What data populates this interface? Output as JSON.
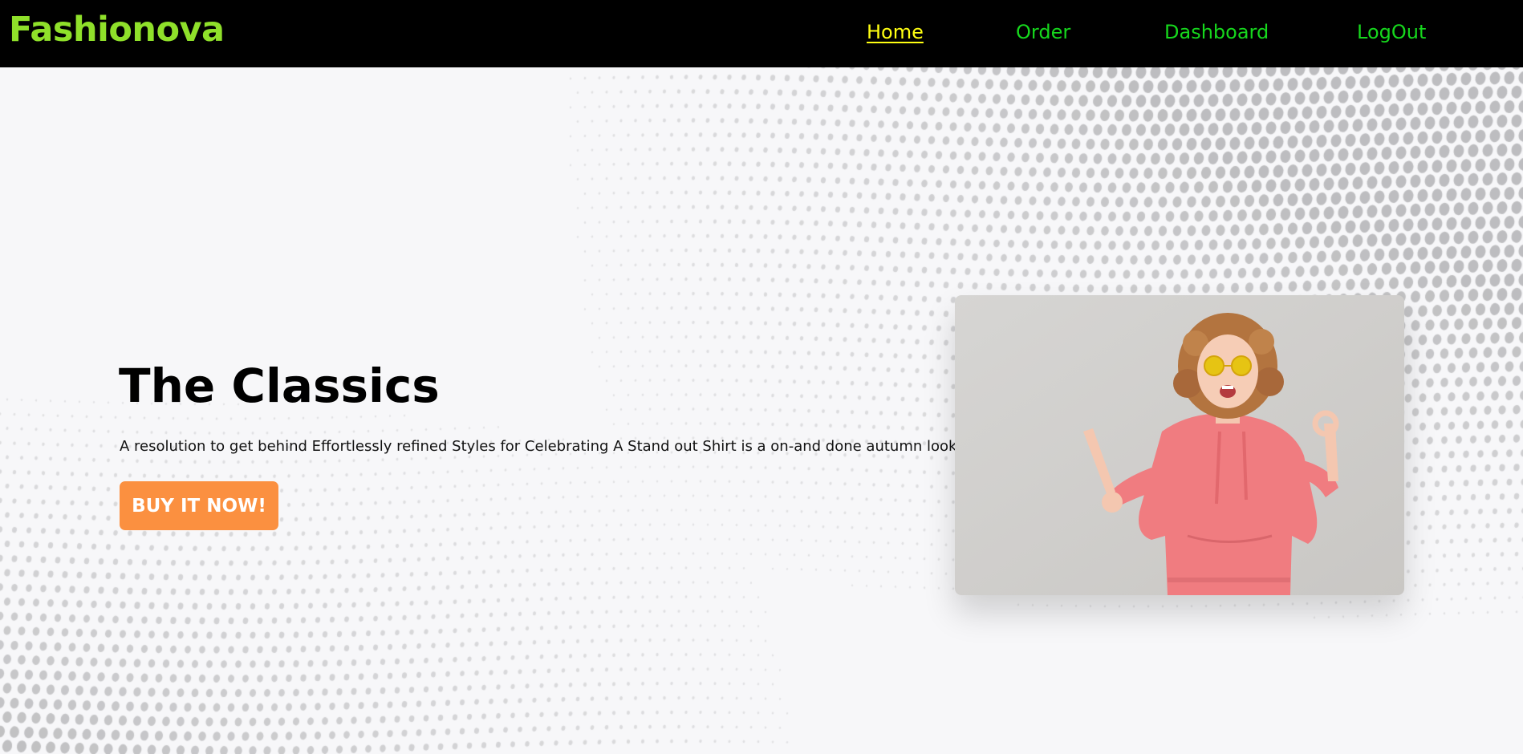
{
  "navbar": {
    "brand": "Fashionova",
    "links": [
      {
        "label": "Home",
        "active": true
      },
      {
        "label": "Order",
        "active": false
      },
      {
        "label": "Dashboard",
        "active": false
      },
      {
        "label": "LogOut",
        "active": false
      }
    ]
  },
  "hero": {
    "title": "The Classics",
    "subtitle": "A resolution to get behind Effortlessly refined Styles for Celebrating A Stand out Shirt is a on-and done autumn look",
    "cta_label": "BUY IT NOW!"
  },
  "colors": {
    "navbar_bg": "#000000",
    "brand": "#8fe02a",
    "nav_link": "#16d81d",
    "nav_active": "#ffff12",
    "cta": "#fb9040",
    "page_bg": "#f7f7f9"
  }
}
